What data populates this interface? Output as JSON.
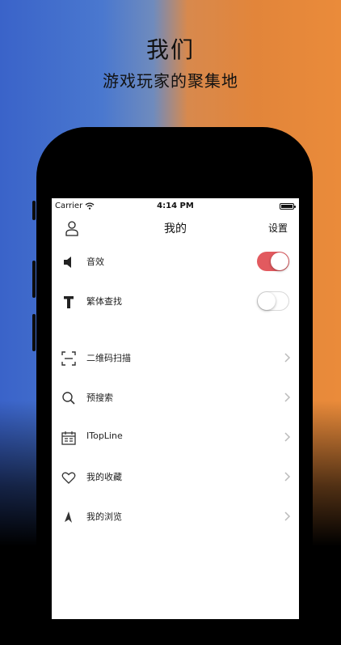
{
  "hero": {
    "title": "我们",
    "subtitle": "游戏玩家的聚集地"
  },
  "status_bar": {
    "carrier": "Carrier",
    "time": "4:14 PM"
  },
  "nav": {
    "title": "我的",
    "settings_label": "设置"
  },
  "toggles": [
    {
      "label": "音效",
      "icon": "speaker-icon",
      "on": true
    },
    {
      "label": "繁体查找",
      "icon": "text-t-icon",
      "on": false
    }
  ],
  "menu": [
    {
      "label": "二维码扫描",
      "icon": "scan-icon"
    },
    {
      "label": "预搜索",
      "icon": "search-icon"
    },
    {
      "label": "ITopLine",
      "icon": "calendar-icon"
    },
    {
      "label": "我的收藏",
      "icon": "heart-icon"
    },
    {
      "label": "我的浏览",
      "icon": "compass-icon"
    }
  ],
  "colors": {
    "toggle_on": "#e25a5f",
    "accent_left": "#3a63c9",
    "accent_right": "#e2853a"
  }
}
